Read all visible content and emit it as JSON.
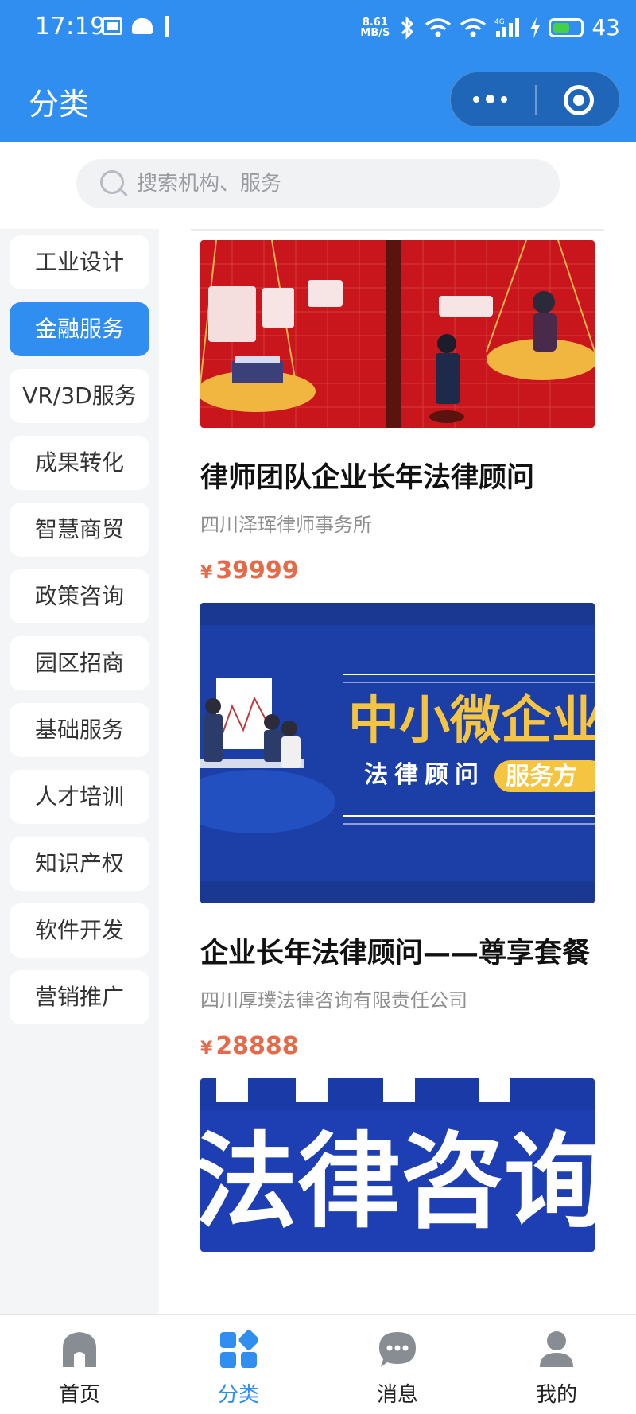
{
  "status_bar": {
    "time": "17:19",
    "network_speed_value": "8.61",
    "network_speed_unit": "MB/S",
    "battery": "43",
    "cell_label": "4G"
  },
  "header": {
    "title": "分类"
  },
  "search": {
    "placeholder": "搜索机构、服务"
  },
  "categories": [
    {
      "label": "工业设计"
    },
    {
      "label": "金融服务",
      "active": true
    },
    {
      "label": "VR/3D服务"
    },
    {
      "label": "成果转化"
    },
    {
      "label": "智慧商贸"
    },
    {
      "label": "政策咨询"
    },
    {
      "label": "园区招商"
    },
    {
      "label": "基础服务"
    },
    {
      "label": "人才培训"
    },
    {
      "label": "知识产权"
    },
    {
      "label": "软件开发"
    },
    {
      "label": "营销推广"
    }
  ],
  "products": [
    {
      "title": "律师团队企业长年法律顾问",
      "org": "四川泽珲律师事务所",
      "currency": "¥",
      "price": "39999"
    },
    {
      "title": "企业长年法律顾问——尊享套餐",
      "org": "四川厚璞法律咨询有限责任公司",
      "currency": "¥",
      "price": "28888",
      "banner_text": "中小微企业",
      "banner_sub": "法律顾问",
      "banner_tag": "服务方"
    },
    {
      "banner_text": "法律咨询"
    }
  ],
  "tabbar": [
    {
      "label": "首页",
      "icon": "home-icon"
    },
    {
      "label": "分类",
      "icon": "category-icon",
      "active": true
    },
    {
      "label": "消息",
      "icon": "message-icon"
    },
    {
      "label": "我的",
      "icon": "profile-icon"
    }
  ],
  "colors": {
    "primary": "#2f8ef0",
    "price": "#e46a4a",
    "sidebar_bg": "#f4f5f7"
  }
}
